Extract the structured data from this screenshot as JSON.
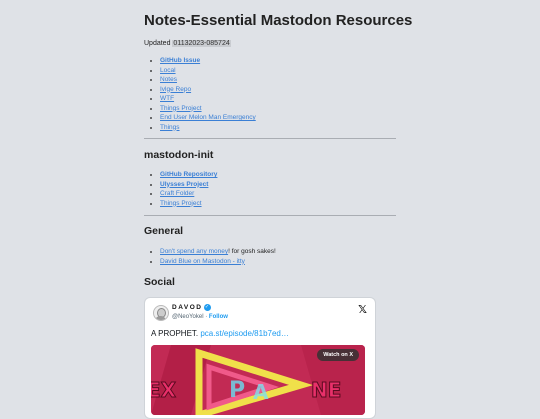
{
  "title": "Notes-Essential Mastodon Resources",
  "updated": {
    "label": "Updated",
    "value": "01132023-085724"
  },
  "top_links": [
    {
      "label": "GitHub Issue"
    },
    {
      "label": "Local"
    },
    {
      "label": "Notes"
    },
    {
      "label": "Ivlge Repo"
    },
    {
      "label": "WTF"
    },
    {
      "label": "Things Project"
    },
    {
      "label": "End User Melon Man Emergency"
    },
    {
      "label": "Things"
    }
  ],
  "sections": {
    "init": {
      "heading": "mastodon-init",
      "links": [
        {
          "label": "GitHub Repository"
        },
        {
          "label": "Ulysses Project"
        },
        {
          "label": "Craft Folder"
        },
        {
          "label": "Things Project"
        }
      ]
    },
    "general": {
      "heading": "General",
      "item1_link": "Don't spend any money",
      "item1_text": "! for gosh sakes!",
      "item2_link": "David Blue on Mastodon - itty"
    },
    "social": {
      "heading": "Social"
    }
  },
  "tweet": {
    "author": "DAVOD",
    "verified_glyph": "✓",
    "handle": "@NeoYokel",
    "separator": " · ",
    "follow": "Follow",
    "x_logo": "𝕏",
    "text": "A PROPHET. ",
    "link": "pca.st/episode/81b7ed…",
    "watch": "Watch on X"
  },
  "colors": {
    "background": "#dfe2e7",
    "link": "#3a7fd5",
    "twitter_blue": "#1d9bf0",
    "video_bg": "#c12c55"
  }
}
